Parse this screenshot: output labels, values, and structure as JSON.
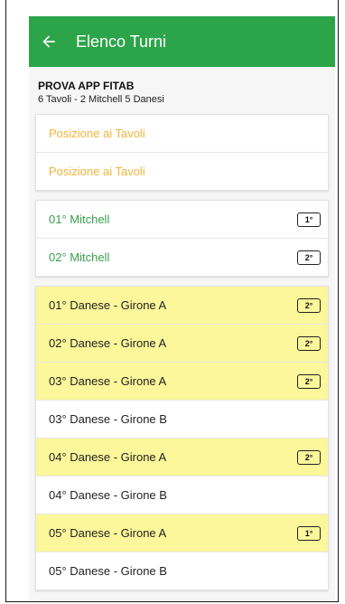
{
  "appbar": {
    "title": "Elenco Turni",
    "back_icon": "arrow-left-icon",
    "color": "#2ca44a"
  },
  "event": {
    "name": "PROVA APP FITAB",
    "details": "6 Tavoli - 2 Mitchell 5 Danesi"
  },
  "positions": [
    {
      "label": "Posizione ai Tavoli"
    },
    {
      "label": "Posizione ai Tavoli"
    }
  ],
  "mitchell": [
    {
      "label": "01° Mitchell",
      "badge": "1°"
    },
    {
      "label": "02° Mitchell",
      "badge": "2°"
    }
  ],
  "danesi": [
    {
      "label": "01° Danese - Girone A",
      "badge": "2°",
      "highlight": true
    },
    {
      "label": "02° Danese - Girone A",
      "badge": "2°",
      "highlight": true
    },
    {
      "label": "03° Danese - Girone A",
      "badge": "2°",
      "highlight": true
    },
    {
      "label": "03° Danese - Girone B",
      "badge": "",
      "highlight": false
    },
    {
      "label": "04° Danese - Girone A",
      "badge": "2°",
      "highlight": true
    },
    {
      "label": "04° Danese - Girone B",
      "badge": "",
      "highlight": false
    },
    {
      "label": "05° Danese - Girone A",
      "badge": "1°",
      "highlight": true
    },
    {
      "label": "05° Danese - Girone B",
      "badge": "",
      "highlight": false
    }
  ],
  "colors": {
    "highlight": "#fbf79a",
    "position_text": "#f2b43a",
    "mitchell_text": "#3a9d4f"
  }
}
